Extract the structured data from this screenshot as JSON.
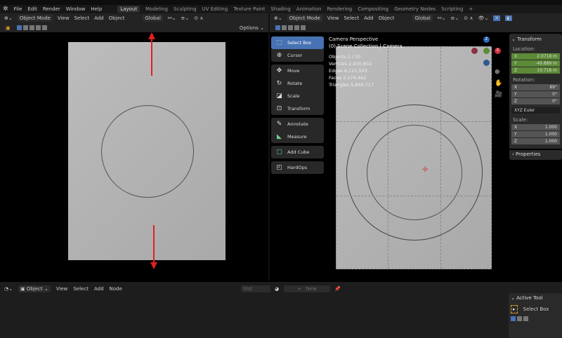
{
  "menu": [
    "File",
    "Edit",
    "Render",
    "Window",
    "Help"
  ],
  "workspaces": [
    "Layout",
    "Modeling",
    "Sculpting",
    "UV Editing",
    "Texture Paint",
    "Shading",
    "Animation",
    "Rendering",
    "Compositing",
    "Geometry Nodes",
    "Scripting",
    "+"
  ],
  "header": {
    "mode": "Object Mode",
    "view": "View",
    "select": "Select",
    "add": "Add",
    "object": "Object",
    "orientation": "Global",
    "options": "Options"
  },
  "viewport": {
    "title": "Camera Perspective",
    "collection": "(0) Scene Collection | Camera.",
    "stats": [
      {
        "label": "Objects",
        "value": "1 / 50"
      },
      {
        "label": "Vertices",
        "value": "2,930,602"
      },
      {
        "label": "Edges",
        "value": "6,111,503"
      },
      {
        "label": "Faces",
        "value": "3,174,462"
      },
      {
        "label": "Triangles",
        "value": "5,840,717"
      }
    ]
  },
  "tools": [
    [
      "Select Box",
      "Cursor"
    ],
    [
      "Move",
      "Rotate",
      "Scale",
      "Transform"
    ],
    [
      "Annotate",
      "Measure"
    ],
    [
      "Add Cube"
    ],
    [
      "HardOps"
    ]
  ],
  "gizmo": {
    "z": "Z",
    "x": "X"
  },
  "transform": {
    "title": "Transform",
    "location_label": "Location:",
    "location": [
      [
        "X",
        "2.0718 m"
      ],
      [
        "Y",
        "-49.889 m"
      ],
      [
        "Z",
        "10.718 m"
      ]
    ],
    "rotation_label": "Rotation:",
    "rotation": [
      [
        "X",
        "89°"
      ],
      [
        "Y",
        "0°"
      ],
      [
        "Z",
        "0°"
      ]
    ],
    "rotation_mode": "XYZ Euler",
    "scale_label": "Scale:",
    "scale": [
      [
        "X",
        "1.000"
      ],
      [
        "Y",
        "1.000"
      ],
      [
        "Z",
        "1.000"
      ]
    ],
    "properties": "Properties"
  },
  "node_editor": {
    "object": "Object",
    "view": "View",
    "select": "Select",
    "add": "Add",
    "node": "Node",
    "slot": "Slot",
    "new": "New"
  },
  "active_tool": {
    "title": "Active Tool",
    "tool": "Select Box"
  },
  "colors": {
    "accent": "#4772b3",
    "green": "#5c8a37",
    "arrow": "#e02020"
  }
}
